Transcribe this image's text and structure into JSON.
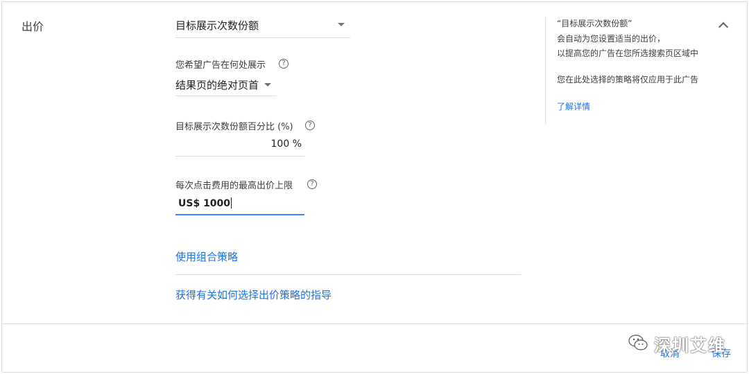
{
  "section": {
    "title": "出价"
  },
  "bidding": {
    "strategy_value": "目标展示次数份额",
    "position": {
      "label": "您希望广告在何处展示",
      "value": "结果页的绝对页首"
    },
    "impression_share": {
      "label": "目标展示次数份额百分比 (%)",
      "value": "100 %"
    },
    "max_cpc": {
      "label": "每次点击费用的最高出价上限",
      "value": "US$ 1000"
    },
    "help_glyph": "?",
    "links": {
      "portfolio": "使用组合策略",
      "guidance": "获得有关如何选择出价策略的指导"
    }
  },
  "side_panel": {
    "title": "“目标展示次数份额”",
    "line1": "会自动为您设置适当的出价，",
    "line2": "以提高您的广告在您所选搜索页区域中",
    "line3": "您在此处选择的策略将仅应用于此广告",
    "learn_more": "了解详情"
  },
  "footer": {
    "cancel": "取消",
    "save": "保存"
  },
  "watermark": {
    "text": "深圳艾维"
  },
  "colors": {
    "accent": "#1a73e8",
    "focus_underline": "#4285f4",
    "border": "#dadce0"
  }
}
